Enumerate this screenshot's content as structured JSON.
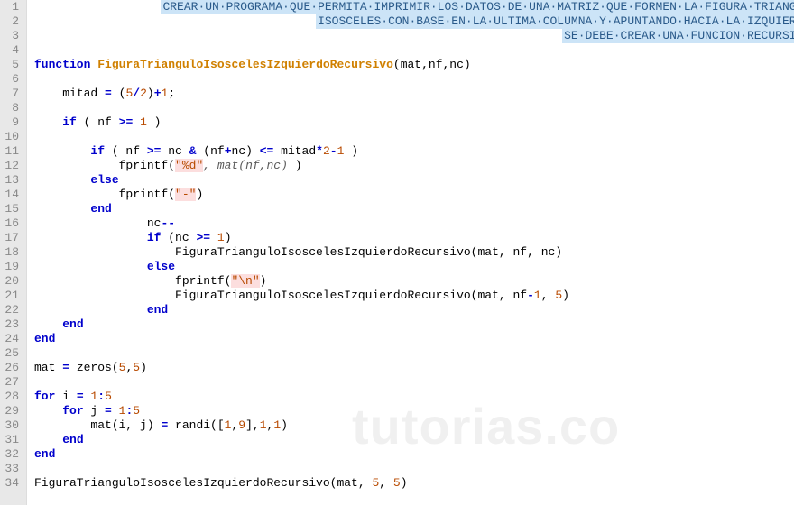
{
  "editor": {
    "lines": [
      {
        "n": 1,
        "type": "comment",
        "text": "CREAR UN PROGRAMA QUE PERMITA IMPRIMIR LOS DATOS DE UNA MATRIZ QUE FORMEN LA FIGURA TRIANGULO",
        "indent": 0,
        "align": "right"
      },
      {
        "n": 2,
        "type": "comment",
        "text": "ISOSCELES CON BASE EN LA ULTIMA COLUMNA Y APUNTANDO HACIA LA IZQUIERDA",
        "indent": 0,
        "align": "right"
      },
      {
        "n": 3,
        "type": "comment",
        "text": "SE DEBE CREAR UNA FUNCION RECURSIVA",
        "indent": 0,
        "align": "right"
      },
      {
        "n": 4,
        "type": "blank"
      },
      {
        "n": 5,
        "type": "code",
        "tokens": [
          [
            "kw",
            "function"
          ],
          [
            "sp",
            " "
          ],
          [
            "fn",
            "FiguraTrianguloIsoscelesIzquierdoRecursivo"
          ],
          [
            "plain",
            "(mat,nf,nc)"
          ]
        ]
      },
      {
        "n": 6,
        "type": "blank"
      },
      {
        "n": 7,
        "type": "code",
        "indent": 1,
        "tokens": [
          [
            "plain",
            "mitad "
          ],
          [
            "op",
            "="
          ],
          [
            "plain",
            " ("
          ],
          [
            "num",
            "5"
          ],
          [
            "op",
            "/"
          ],
          [
            "num",
            "2"
          ],
          [
            "plain",
            ")"
          ],
          [
            "op",
            "+"
          ],
          [
            "num",
            "1"
          ],
          [
            "plain",
            ";"
          ]
        ]
      },
      {
        "n": 8,
        "type": "blank"
      },
      {
        "n": 9,
        "type": "code",
        "indent": 1,
        "tokens": [
          [
            "kw",
            "if"
          ],
          [
            "plain",
            " ( nf "
          ],
          [
            "op",
            ">="
          ],
          [
            "plain",
            " "
          ],
          [
            "num",
            "1"
          ],
          [
            "plain",
            " )"
          ]
        ]
      },
      {
        "n": 10,
        "type": "blank"
      },
      {
        "n": 11,
        "type": "code",
        "indent": 2,
        "tokens": [
          [
            "kw",
            "if"
          ],
          [
            "plain",
            " ( nf "
          ],
          [
            "op",
            ">="
          ],
          [
            "plain",
            " nc "
          ],
          [
            "op",
            "&"
          ],
          [
            "plain",
            " (nf"
          ],
          [
            "op",
            "+"
          ],
          [
            "plain",
            "nc) "
          ],
          [
            "op",
            "<="
          ],
          [
            "plain",
            " mitad"
          ],
          [
            "op",
            "*"
          ],
          [
            "num",
            "2"
          ],
          [
            "op",
            "-"
          ],
          [
            "num",
            "1"
          ],
          [
            "plain",
            " )"
          ]
        ]
      },
      {
        "n": 12,
        "type": "code",
        "indent": 3,
        "tokens": [
          [
            "plain",
            "fprintf("
          ],
          [
            "strbg",
            "\"%d\""
          ],
          [
            "phfn",
            ", mat(nf,nc) "
          ],
          [
            "plain",
            ")"
          ]
        ]
      },
      {
        "n": 13,
        "type": "code",
        "indent": 2,
        "tokens": [
          [
            "kw",
            "else"
          ]
        ]
      },
      {
        "n": 14,
        "type": "code",
        "indent": 3,
        "tokens": [
          [
            "plain",
            "fprintf("
          ],
          [
            "strbg",
            "\"-\""
          ],
          [
            "plain",
            ")"
          ]
        ]
      },
      {
        "n": 15,
        "type": "code",
        "indent": 2,
        "tokens": [
          [
            "kw",
            "end"
          ]
        ]
      },
      {
        "n": 16,
        "type": "code",
        "indent": 4,
        "tokens": [
          [
            "plain",
            "nc"
          ],
          [
            "op",
            "--"
          ]
        ]
      },
      {
        "n": 17,
        "type": "code",
        "indent": 4,
        "tokens": [
          [
            "kw",
            "if"
          ],
          [
            "plain",
            " (nc "
          ],
          [
            "op",
            ">="
          ],
          [
            "plain",
            " "
          ],
          [
            "num",
            "1"
          ],
          [
            "plain",
            ")"
          ]
        ]
      },
      {
        "n": 18,
        "type": "code",
        "indent": 5,
        "tokens": [
          [
            "plain",
            "FiguraTrianguloIsoscelesIzquierdoRecursivo(mat, nf, nc)"
          ]
        ]
      },
      {
        "n": 19,
        "type": "code",
        "indent": 4,
        "tokens": [
          [
            "kw",
            "else"
          ]
        ]
      },
      {
        "n": 20,
        "type": "code",
        "indent": 5,
        "tokens": [
          [
            "plain",
            "fprintf("
          ],
          [
            "strbg",
            "\"\\n\""
          ],
          [
            "plain",
            ")"
          ]
        ]
      },
      {
        "n": 21,
        "type": "code",
        "indent": 5,
        "tokens": [
          [
            "plain",
            "FiguraTrianguloIsoscelesIzquierdoRecursivo(mat, nf"
          ],
          [
            "op",
            "-"
          ],
          [
            "num",
            "1"
          ],
          [
            "plain",
            ", "
          ],
          [
            "num",
            "5"
          ],
          [
            "plain",
            ")"
          ]
        ]
      },
      {
        "n": 22,
        "type": "code",
        "indent": 4,
        "tokens": [
          [
            "kw",
            "end"
          ]
        ]
      },
      {
        "n": 23,
        "type": "code",
        "indent": 1,
        "tokens": [
          [
            "kw",
            "end"
          ]
        ]
      },
      {
        "n": 24,
        "type": "code",
        "indent": 0,
        "tokens": [
          [
            "kw",
            "end"
          ]
        ]
      },
      {
        "n": 25,
        "type": "blank"
      },
      {
        "n": 26,
        "type": "code",
        "indent": 0,
        "tokens": [
          [
            "plain",
            "mat "
          ],
          [
            "op",
            "="
          ],
          [
            "plain",
            " zeros("
          ],
          [
            "num",
            "5"
          ],
          [
            "plain",
            ","
          ],
          [
            "num",
            "5"
          ],
          [
            "plain",
            ")"
          ]
        ]
      },
      {
        "n": 27,
        "type": "blank"
      },
      {
        "n": 28,
        "type": "code",
        "indent": 0,
        "tokens": [
          [
            "kw",
            "for"
          ],
          [
            "plain",
            " i "
          ],
          [
            "op",
            "="
          ],
          [
            "plain",
            " "
          ],
          [
            "num",
            "1"
          ],
          [
            "op",
            ":"
          ],
          [
            "num",
            "5"
          ]
        ]
      },
      {
        "n": 29,
        "type": "code",
        "indent": 1,
        "tokens": [
          [
            "kw",
            "for"
          ],
          [
            "plain",
            " j "
          ],
          [
            "op",
            "="
          ],
          [
            "plain",
            " "
          ],
          [
            "num",
            "1"
          ],
          [
            "op",
            ":"
          ],
          [
            "num",
            "5"
          ]
        ]
      },
      {
        "n": 30,
        "type": "code",
        "indent": 2,
        "tokens": [
          [
            "plain",
            "mat(i, j) "
          ],
          [
            "op",
            "="
          ],
          [
            "plain",
            " randi(["
          ],
          [
            "num",
            "1"
          ],
          [
            "plain",
            ","
          ],
          [
            "num",
            "9"
          ],
          [
            "plain",
            "],"
          ],
          [
            "num",
            "1"
          ],
          [
            "plain",
            ","
          ],
          [
            "num",
            "1"
          ],
          [
            "plain",
            ")"
          ]
        ]
      },
      {
        "n": 31,
        "type": "code",
        "indent": 1,
        "tokens": [
          [
            "kw",
            "end"
          ]
        ]
      },
      {
        "n": 32,
        "type": "code",
        "indent": 0,
        "tokens": [
          [
            "kw",
            "end"
          ]
        ]
      },
      {
        "n": 33,
        "type": "blank"
      },
      {
        "n": 34,
        "type": "code",
        "indent": 0,
        "tokens": [
          [
            "plain",
            "FiguraTrianguloIsoscelesIzquierdoRecursivo(mat, "
          ],
          [
            "num",
            "5"
          ],
          [
            "plain",
            ", "
          ],
          [
            "num",
            "5"
          ],
          [
            "plain",
            ")"
          ]
        ]
      }
    ]
  },
  "watermark": "tutorias.co"
}
